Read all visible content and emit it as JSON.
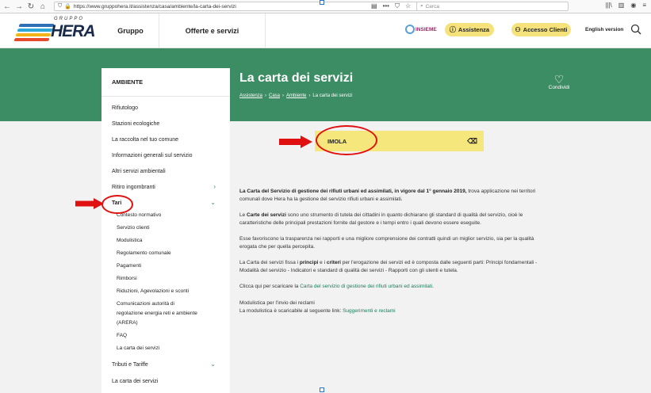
{
  "browser": {
    "url": "https://www.gruppohera.it/assistenza/casa/ambiente/la-carta-dei-servizi",
    "search_placeholder": "Cerca"
  },
  "header": {
    "logo_top": "GRUPPO",
    "logo_main": "HERA",
    "nav": [
      "Gruppo",
      "Offerte e servizi"
    ],
    "insieme": "INSIEME",
    "assistenza": "Assistenza",
    "accesso": "Accesso Clienti",
    "english": "English version"
  },
  "sidebar": {
    "title": "AMBIENTE",
    "items": [
      {
        "label": "Rifiutologo"
      },
      {
        "label": "Stazioni ecologiche"
      },
      {
        "label": "La raccolta nel tuo comune"
      },
      {
        "label": "Informazioni generali sul servizio"
      },
      {
        "label": "Altri servizi ambientali"
      },
      {
        "label": "Ritiro ingombranti"
      },
      {
        "label": "Tari"
      },
      {
        "label": "Tributi e Tariffe"
      },
      {
        "label": "La carta dei servizi"
      }
    ],
    "tari_sub": [
      "Contesto normativo",
      "Servizio clienti",
      "Modulistica",
      "Regolamento comunale",
      "Pagamenti",
      "Rimborsi",
      "Riduzioni, Agevolazioni e sconti",
      "Comunicazioni autorità di",
      "regolazione energia reti e ambiente",
      "(ARERA)",
      "FAQ",
      "La carta dei servizi"
    ]
  },
  "page": {
    "title": "La carta dei servizi",
    "breadcrumb": [
      "Assistenza",
      "Casa",
      "Ambiente",
      "La carta dei servizi"
    ],
    "share": "Condividi",
    "city": "IMOLA"
  },
  "content": {
    "p1_bold": "La Carta del Servizio di gestione dei rifiuti urbani ed assimilati, in vigore dal 1° gennaio 2019,",
    "p1_rest": " trova applicazione nei territori",
    "p1_line2": "comunali dove Hera ha la gestione del servizio rifiuti urbani e assimilati.",
    "p2_a": "Le ",
    "p2_bold": "Carte dei servizi",
    "p2_b": " sono uno strumento di tutela dei cittadini in quanto dichiarano gli standard di qualità del servizio, cioè le",
    "p2_line2": "caratteristiche delle principali prestazioni fornite dal gestore e i tempi entro i quali devono essere eseguite.",
    "p3_line1": "Esse favoriscono la trasparenza nei rapporti e una migliore comprensione dei contratti quindi un miglior servizio, sia per la qualità",
    "p3_line2": "erogata che per quella percepita.",
    "p4_a": "La Carta dei servizi fissa i ",
    "p4_b1": "principi",
    "p4_c": " e i ",
    "p4_b2": "criteri",
    "p4_d": " per l'erogazione dei servizi ed è composta dalle seguenti parti: Principi fondamentali -",
    "p4_line2": "Modalità del servizio - Indicatori e standard di qualità dei servizi - Rapporti con gli utenti e tutela.",
    "p5_a": "Clicca qui per scaricare la ",
    "p5_link": "Carta del servizio di gestione dei rifiuti urbani ed assimilati",
    "p5_b": ".",
    "heading": "Modulistica per l'invio dei reclami",
    "p6_a": "La modulistica è scaricabile al seguente link: ",
    "p6_link": "Suggerimenti e reclami"
  },
  "colors": {
    "green": "#3d8d64",
    "yellow": "#f5e77b",
    "annotation_red": "#e01010"
  }
}
